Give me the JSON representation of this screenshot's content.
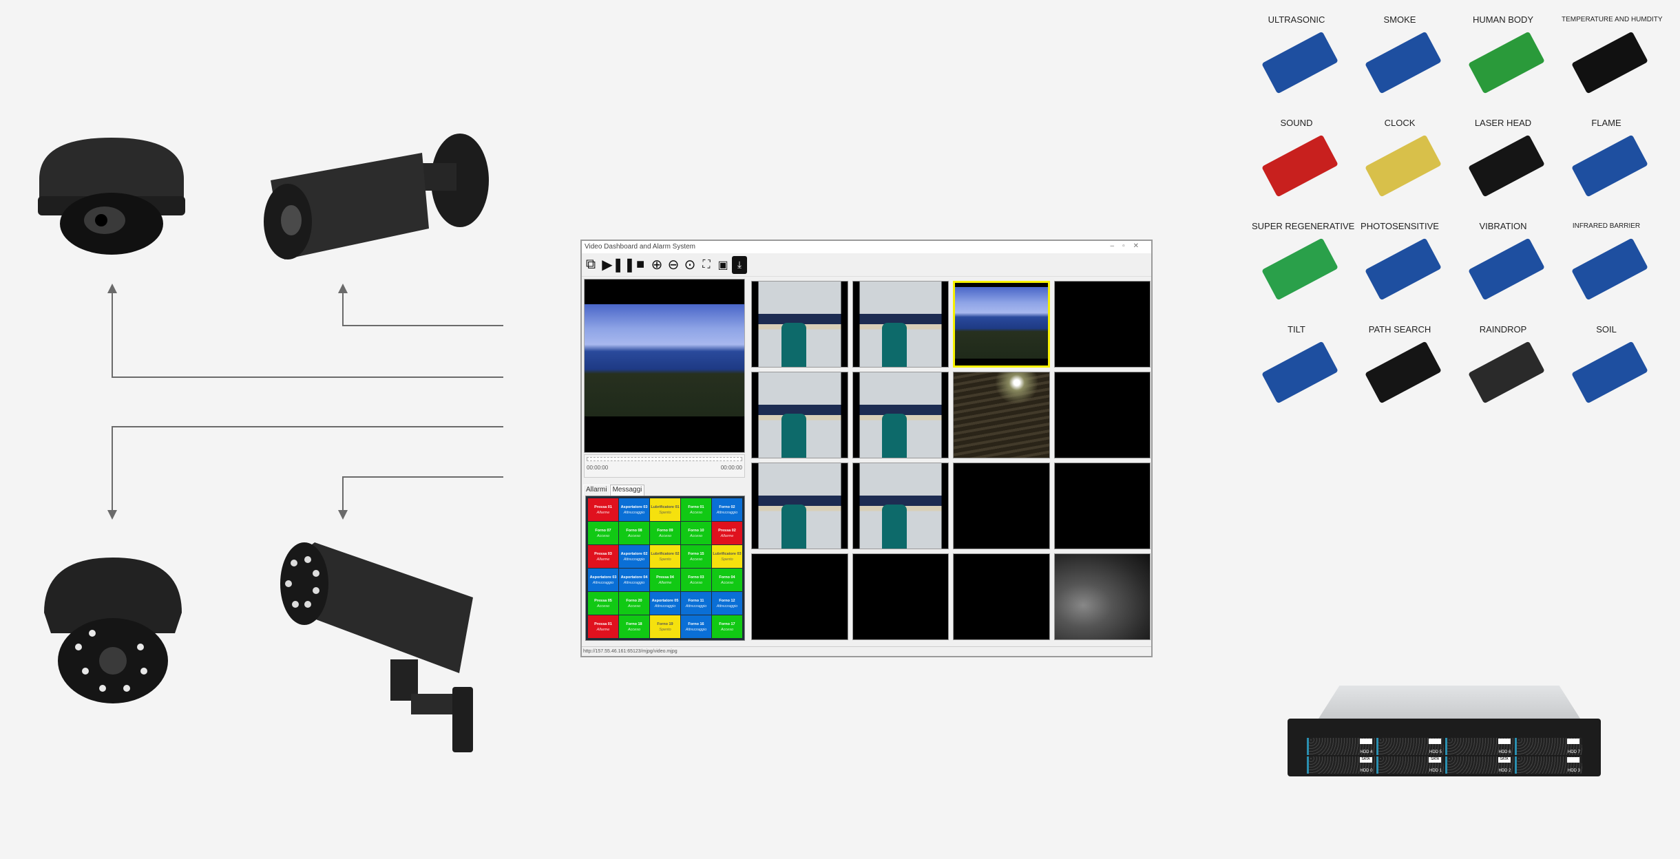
{
  "window": {
    "title": "Video Dashboard and Alarm System",
    "controls": [
      "–",
      "▫",
      "✕"
    ],
    "toolbar": [
      "multi-window-icon",
      "play-icon",
      "pause-icon",
      "stop-icon",
      "zoom-in-icon",
      "zoom-out-icon",
      "zoom-fit-icon",
      "fullscreen-icon",
      "fit-frame-icon",
      "download-icon"
    ],
    "preview": {
      "time_start": "00:00:00",
      "time_end": "00:00:00"
    },
    "tabs": [
      {
        "label": "Allarmi",
        "selected": true
      },
      {
        "label": "Messaggi",
        "selected": false
      }
    ],
    "alarms": [
      [
        {
          "name": "Pressa 01",
          "state": "Allarme",
          "color": "red"
        },
        {
          "name": "Asportatore 03",
          "state": "Attrezzaggio",
          "color": "blue"
        },
        {
          "name": "Lubrificatore 01",
          "state": "Spento",
          "color": "yellow"
        },
        {
          "name": "Forno 01",
          "state": "Acceso",
          "color": "green"
        },
        {
          "name": "Forno 02",
          "state": "Attrezzaggio",
          "color": "blue"
        }
      ],
      [
        {
          "name": "Forno 07",
          "state": "Acceso",
          "color": "green"
        },
        {
          "name": "Forno 08",
          "state": "Acceso",
          "color": "green"
        },
        {
          "name": "Forno 09",
          "state": "Acceso",
          "color": "green"
        },
        {
          "name": "Forno 10",
          "state": "Acceso",
          "color": "green"
        },
        {
          "name": "Pressa 02",
          "state": "Allarme",
          "color": "red"
        }
      ],
      [
        {
          "name": "Pressa 03",
          "state": "Allarme",
          "color": "red"
        },
        {
          "name": "Asportatore 02",
          "state": "Attrezzaggio",
          "color": "blue"
        },
        {
          "name": "Lubrificatore 02",
          "state": "Spento",
          "color": "yellow"
        },
        {
          "name": "Forno 15",
          "state": "Acceso",
          "color": "green"
        },
        {
          "name": "Lubrificatore 03",
          "state": "Spento",
          "color": "yellow"
        }
      ],
      [
        {
          "name": "Asportatore 03",
          "state": "Attrezzaggio",
          "color": "blue"
        },
        {
          "name": "Asportatore 04",
          "state": "Attrezzaggio",
          "color": "blue"
        },
        {
          "name": "Pressa 04",
          "state": "Allarme",
          "color": "green"
        },
        {
          "name": "Forno 03",
          "state": "Acceso",
          "color": "green"
        },
        {
          "name": "Forno 04",
          "state": "Acceso",
          "color": "green"
        }
      ],
      [
        {
          "name": "Pressa 05",
          "state": "Acceso",
          "color": "green"
        },
        {
          "name": "Forno 20",
          "state": "Acceso",
          "color": "green"
        },
        {
          "name": "Asportatore 05",
          "state": "Attrezzaggio",
          "color": "blue"
        },
        {
          "name": "Forno 11",
          "state": "Attrezzaggio",
          "color": "blue"
        },
        {
          "name": "Forno 12",
          "state": "Attrezzaggio",
          "color": "blue"
        }
      ],
      [
        {
          "name": "Pressa 01",
          "state": "Allarme",
          "color": "red"
        },
        {
          "name": "Forno 18",
          "state": "Acceso",
          "color": "green"
        },
        {
          "name": "Forno 19",
          "state": "Spento",
          "color": "yellow"
        },
        {
          "name": "Forno 16",
          "state": "Attrezzaggio",
          "color": "blue"
        },
        {
          "name": "Forno 17",
          "state": "Acceso",
          "color": "green"
        }
      ]
    ],
    "status_url": "http://157.55.46.161:65123/mjpg/video.mjpg",
    "selected_tile": 3
  },
  "sensors": [
    "ULTRASONIC",
    "SMOKE",
    "HUMAN BODY",
    "TEMPERATURE AND HUMDITY",
    "SOUND",
    "CLOCK",
    "LASER HEAD",
    "FLAME",
    "SUPER REGENERATIVE",
    "PHOTOSENSITIVE",
    "VIBRATION",
    "INFRARED BARRIER",
    "TILT",
    "PATH SEARCH",
    "RAINDROP",
    "SOIL"
  ],
  "server": {
    "bays": [
      "HDD 4",
      "HDD 5",
      "HDD 6",
      "HDD 7",
      "HDD 0",
      "HDD 1",
      "HDD 2",
      "HDD 3"
    ],
    "bay_tags": [
      "",
      "",
      "",
      "",
      "SATA",
      "SATA",
      "SATA",
      ""
    ]
  },
  "colors": {
    "red": "#e0111e",
    "blue": "#0a6fd6",
    "yellow": "#f5e10e",
    "green": "#11c914",
    "selection": "#f6f000"
  }
}
